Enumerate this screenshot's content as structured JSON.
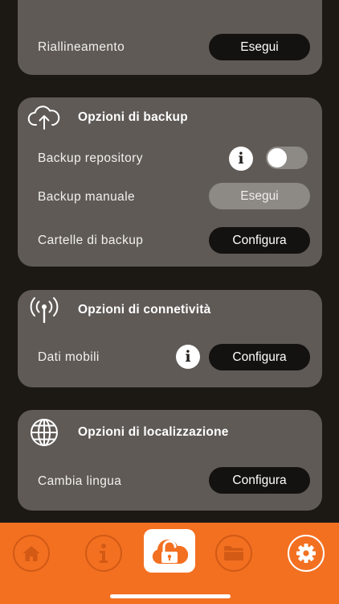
{
  "top_card": {
    "row_label": "Riallineamento",
    "button_label": "Esegui"
  },
  "backup": {
    "title": "Opzioni di backup",
    "rows": [
      {
        "label": "Backup repository",
        "info": "i",
        "toggle_on": false
      },
      {
        "label": "Backup manuale",
        "button_label": "Esegui",
        "button_enabled": false
      },
      {
        "label": "Cartelle di backup",
        "button_label": "Configura"
      }
    ]
  },
  "connectivity": {
    "title": "Opzioni di connetività",
    "row": {
      "label": "Dati mobili",
      "info": "i",
      "button_label": "Configura"
    }
  },
  "localization": {
    "title": "Opzioni di localizzazione",
    "row": {
      "label": "Cambia lingua",
      "button_label": "Configura"
    }
  },
  "tabbar": {
    "tabs": [
      {
        "icon": "home-icon"
      },
      {
        "icon": "info-icon"
      },
      {
        "icon": "cloud-lock-icon",
        "center": true
      },
      {
        "icon": "folder-icon"
      },
      {
        "icon": "gear-icon",
        "active": true
      }
    ]
  },
  "colors": {
    "background": "#1c1814",
    "card": "#5f5a56",
    "accent": "#f37021"
  }
}
